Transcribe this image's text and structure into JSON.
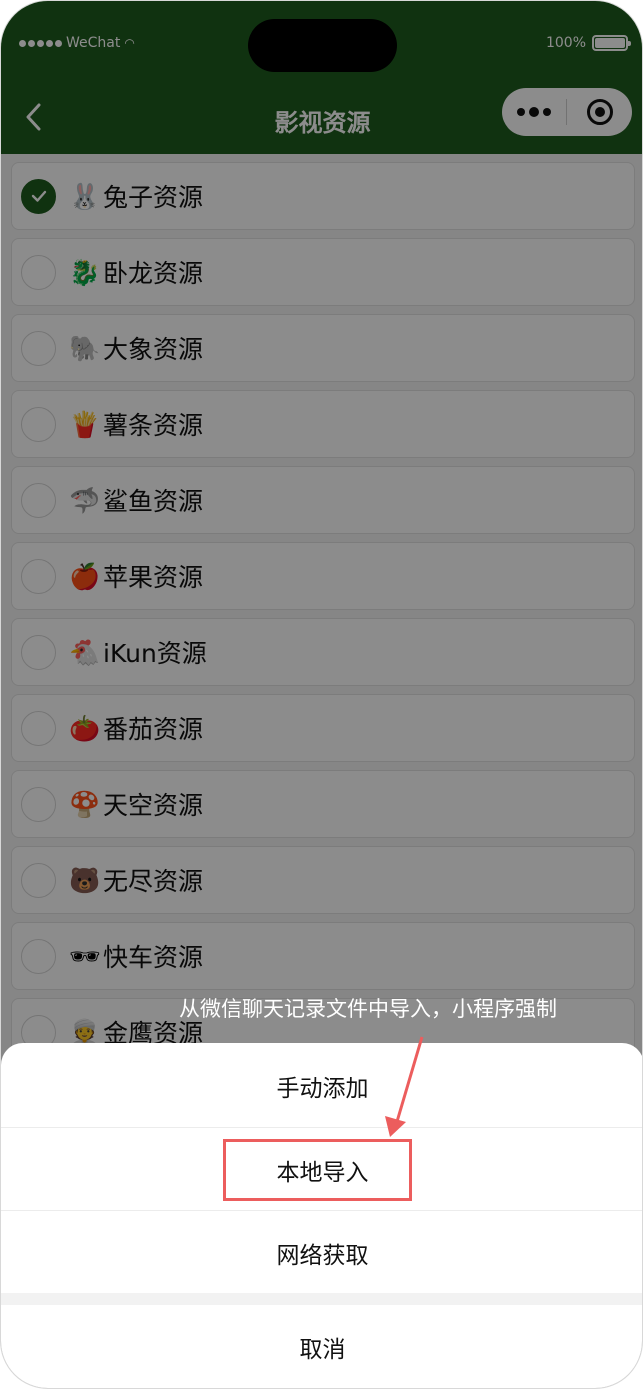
{
  "status_bar": {
    "carrier": "WeChat",
    "battery_percent": "100%"
  },
  "nav": {
    "title": "影视资源",
    "back_icon": "chevron-left-icon",
    "more_icon": "more-dots-icon",
    "close_icon": "target-icon"
  },
  "sources": {
    "items": [
      {
        "emoji": "🐰",
        "label": "兔子资源",
        "checked": true
      },
      {
        "emoji": "🐉",
        "label": "卧龙资源",
        "checked": false
      },
      {
        "emoji": "🐘",
        "label": "大象资源",
        "checked": false
      },
      {
        "emoji": "🍟",
        "label": "薯条资源",
        "checked": false
      },
      {
        "emoji": "🦈",
        "label": "鲨鱼资源",
        "checked": false
      },
      {
        "emoji": "🍎",
        "label": "苹果资源",
        "checked": false
      },
      {
        "emoji": "🐔",
        "label": "iKun资源",
        "checked": false
      },
      {
        "emoji": "🍅",
        "label": "番茄资源",
        "checked": false
      },
      {
        "emoji": "🍄",
        "label": "天空资源",
        "checked": false
      },
      {
        "emoji": "🐻",
        "label": "无尽资源",
        "checked": false
      },
      {
        "emoji": "🕶",
        "label": "快车资源",
        "checked": false
      },
      {
        "emoji": "👳",
        "label": "金鹰资源",
        "checked": false
      }
    ]
  },
  "action_sheet": {
    "manual_add": "手动添加",
    "local_import": "本地导入",
    "network_fetch": "网络获取",
    "cancel": "取消"
  },
  "annotation": {
    "text": "从微信聊天记录文件中导入，小程序强制",
    "color": "#ec5d5d"
  },
  "colors": {
    "nav_bg": "#1e5c1e",
    "check_green": "#1e5c1e"
  }
}
